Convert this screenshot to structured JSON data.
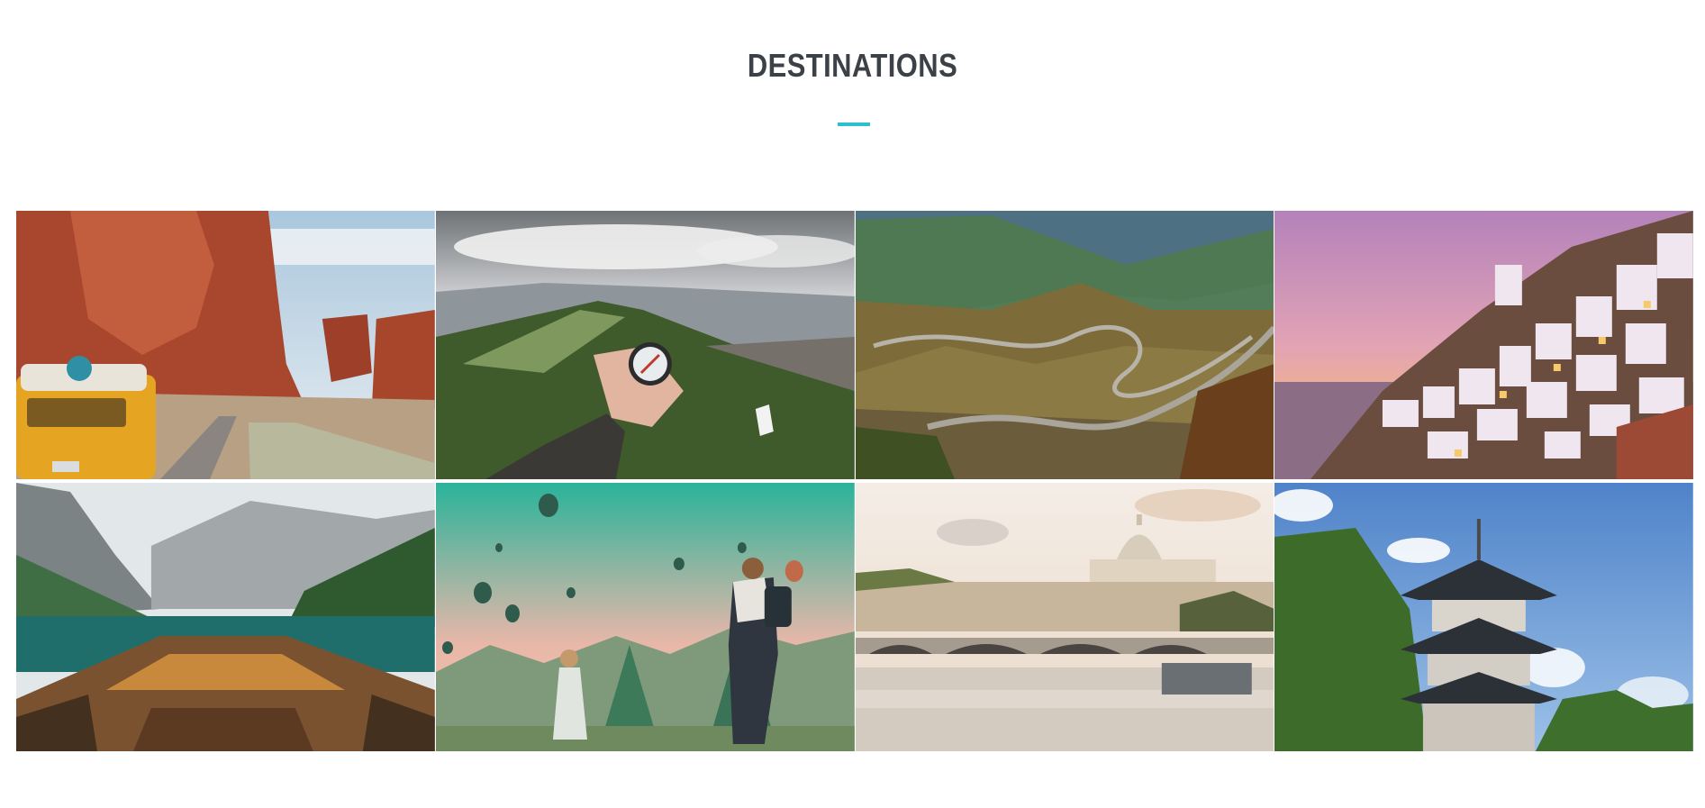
{
  "section": {
    "title": "DESTINATIONS",
    "accent_color": "#2bbfcf"
  },
  "gallery": {
    "items": [
      {
        "icon": "red-rock-canyon-van-photo"
      },
      {
        "icon": "compass-mountain-photo"
      },
      {
        "icon": "winding-mountain-road-photo"
      },
      {
        "icon": "hillside-village-sunset-photo"
      },
      {
        "icon": "lake-boat-mountains-photo"
      },
      {
        "icon": "hot-air-balloons-photo"
      },
      {
        "icon": "river-bridge-dome-photo"
      },
      {
        "icon": "pagoda-sky-photo"
      }
    ]
  }
}
